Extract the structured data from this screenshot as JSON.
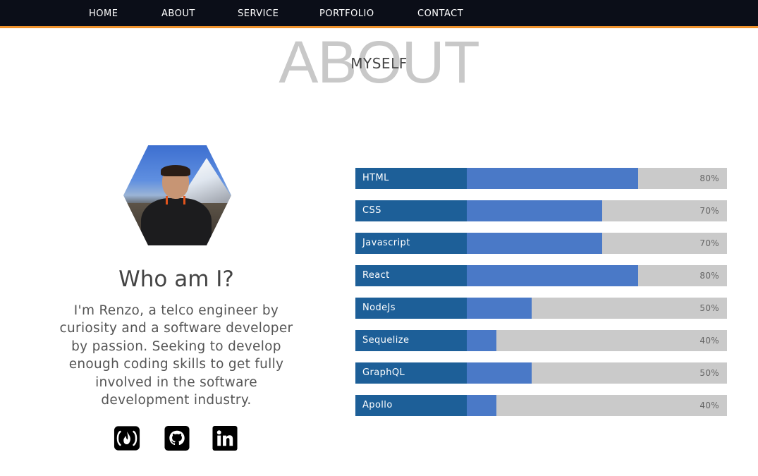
{
  "nav": {
    "items": [
      "HOME",
      "ABOUT",
      "SERVICE",
      "PORTFOLIO",
      "CONTACT"
    ]
  },
  "section": {
    "bg_title": "ABOUT",
    "fg_title": "MYSELF"
  },
  "profile": {
    "heading": "Who am I?",
    "bio": "I'm Renzo, a telco engineer by curiosity and a software developer by passion. Seeking to develop enough coding skills to get fully involved in the software development industry.",
    "social_icons": [
      "freecodecamp-icon",
      "github-icon",
      "linkedin-icon"
    ]
  },
  "skills": [
    {
      "name": "HTML",
      "percent": "80%",
      "level": 0.8
    },
    {
      "name": "CSS",
      "percent": "70%",
      "level": 0.7
    },
    {
      "name": "Javascript",
      "percent": "70%",
      "level": 0.7
    },
    {
      "name": "React",
      "percent": "80%",
      "level": 0.8
    },
    {
      "name": "NodeJs",
      "percent": "50%",
      "level": 0.5
    },
    {
      "name": "Sequelize",
      "percent": "40%",
      "level": 0.4
    },
    {
      "name": "GraphQL",
      "percent": "50%",
      "level": 0.5
    },
    {
      "name": "Apollo",
      "percent": "40%",
      "level": 0.4
    }
  ],
  "colors": {
    "nav_bg": "#0b0e18",
    "nav_accent": "#f0922c",
    "skill_label_bg": "#1d5f98",
    "skill_fill": "#4a79c7",
    "skill_track": "#cacaca"
  }
}
